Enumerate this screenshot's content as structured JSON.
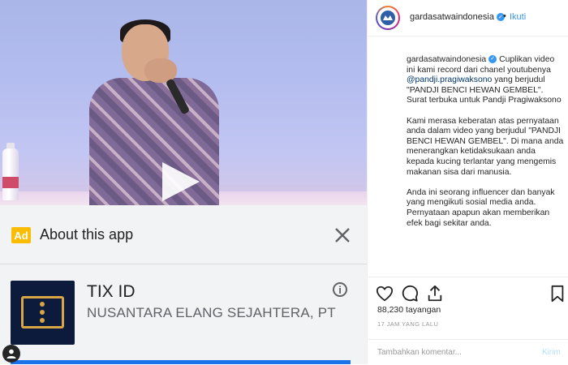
{
  "ad": {
    "badge": "Ad",
    "title": "About this app",
    "app_name": "TIX ID",
    "developer": "NUSANTARA ELANG SEJAHTERA, PT",
    "info_glyph": "i"
  },
  "post": {
    "username": "gardasatwaindonesia",
    "verified_glyph": "✓",
    "separator": "•",
    "follow_label": "Ikuti",
    "caption_username": "gardasatwaindonesia",
    "caption_p1_a": "Cuplikan video ini kami record dari chanel youtubenya",
    "caption_mention": "@pandji.pragiwaksono",
    "caption_p1_b": "yang berjudul \"PANDJI BENCI HEWAN GEMBEL\". Surat terbuka untuk Pandji Pragiwaksono",
    "caption_p2": "Kami merasa keberatan atas pernyataan anda dalam video yang berjudul \"PANDJI BENCI HEWAN GEMBEL\". Di mana anda menerangkan ketidaksukaan anda kepada kucing terlantar yang mengemis makanan sisa dari manusia.",
    "caption_p3": "Anda ini seorang influencer dan banyak yang mengikuti sosial media anda. Pernyataan apapun akan memberikan efek bagi sekitar anda.",
    "views": "88,230 tayangan",
    "time_ago": "17 JAM YANG LALU",
    "comment_placeholder": "Tambahkan komentar...",
    "send_label": "Kirim"
  },
  "icons": {
    "like": "heart-icon",
    "comment": "comment-icon",
    "share": "share-icon",
    "save": "bookmark-icon",
    "close": "close-icon",
    "play": "play-icon",
    "user_tag": "user-icon"
  },
  "colors": {
    "ad_badge": "#fbbc04",
    "link_blue": "#3897f0",
    "install_blue": "#1a73e8",
    "app_icon_bg": "#0c1a3c",
    "ticket_gold": "#d9a443"
  }
}
